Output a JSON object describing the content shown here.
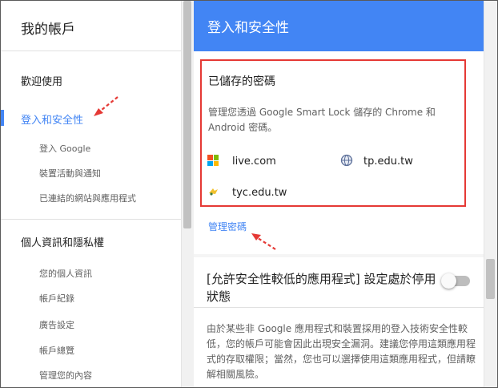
{
  "sidebar": {
    "title": "我的帳戶",
    "items": [
      {
        "label": "歡迎使用"
      },
      {
        "label": "登入和安全性",
        "active": true
      },
      {
        "label": "個人資訊和隱私權"
      }
    ],
    "security_subitems": [
      "登入 Google",
      "裝置活動與通知",
      "已連結的網站與應用程式"
    ],
    "privacy_subitems": [
      "您的個人資訊",
      "帳戶紀錄",
      "廣告設定",
      "帳戶總覽",
      "管理您的內容"
    ]
  },
  "header": {
    "title": "登入和安全性"
  },
  "passwords": {
    "title": "已儲存的密碼",
    "description": "管理您透過 Google Smart Lock 儲存的 Chrome 和 Android 密碼。",
    "sites": [
      {
        "name": "live.com",
        "icon": "windows-logo-icon"
      },
      {
        "name": "tp.edu.tw",
        "icon": "globe-icon"
      },
      {
        "name": "tyc.edu.tw",
        "icon": "site-favicon-icon"
      }
    ],
    "manage_link": "管理密碼"
  },
  "less_secure": {
    "title": "[允許安全性較低的應用程式] 設定處於停用狀態",
    "toggle_on": false,
    "description": "由於某些非 Google 應用程式和裝置採用的登入技術安全性較低，您的帳戶可能會因此出現安全漏洞。建議您停用這類應用程式的存取權限；當然，您也可以選擇使用這類應用程式，但請瞭解相關風險。"
  },
  "colors": {
    "accent": "#4285f4",
    "highlight_border": "#e53935",
    "annotation_arrow": "#e53935"
  }
}
